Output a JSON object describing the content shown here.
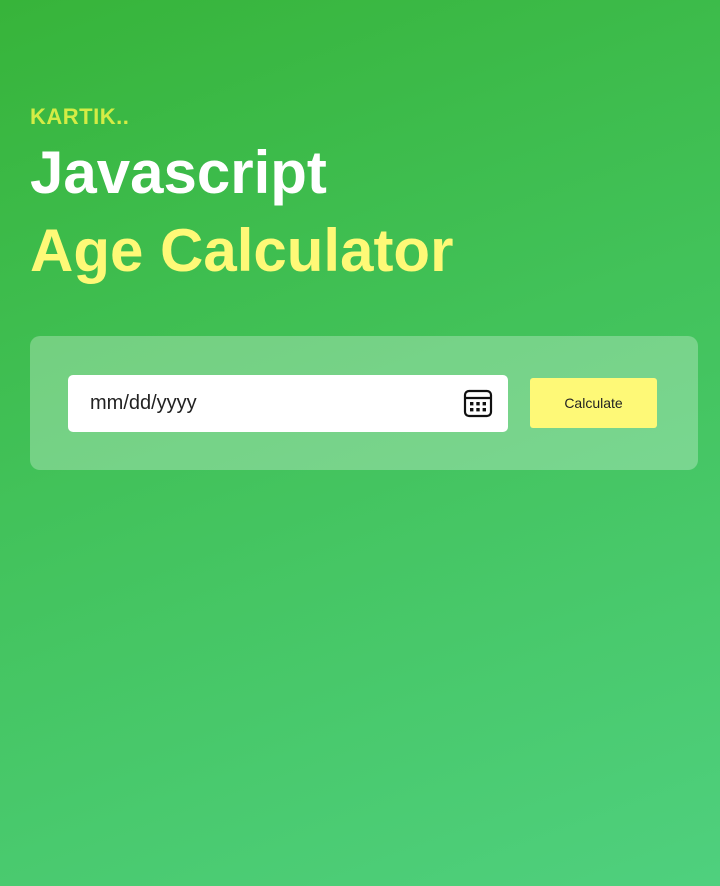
{
  "header": {
    "brand": "KARTIK..",
    "title_line1": "Javascript",
    "title_line2": "Age Calculator"
  },
  "form": {
    "date_placeholder": "mm/dd/yyyy",
    "date_value": "",
    "calendar_icon": "calendar-icon",
    "calculate_label": "Calculate"
  },
  "colors": {
    "background_start": "#37b43a",
    "background_end": "#4fd07e",
    "brand": "#d4ec45",
    "title_primary": "#ffffff",
    "title_accent": "#fef977",
    "button": "#fef977"
  }
}
